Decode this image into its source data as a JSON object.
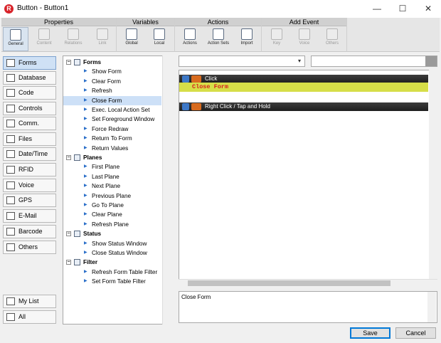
{
  "window": {
    "title": "Button - Button1",
    "app_icon_letter": "R",
    "controls": {
      "minimize": "—",
      "maximize": "☐",
      "close": "✕"
    }
  },
  "ribbon": {
    "groups": [
      {
        "label": "Properties",
        "buttons": [
          {
            "label": "General",
            "icon": "general-icon",
            "state": "selected"
          },
          {
            "label": "Content",
            "icon": "content-icon",
            "state": "disabled"
          },
          {
            "label": "Relations",
            "icon": "relations-icon",
            "state": "disabled"
          },
          {
            "label": "Link",
            "icon": "link-icon",
            "state": "disabled"
          }
        ]
      },
      {
        "label": "Variables",
        "buttons": [
          {
            "label": "Global",
            "icon": "global-variable-icon",
            "state": "normal"
          },
          {
            "label": "Local",
            "icon": "local-variable-icon",
            "state": "normal"
          }
        ]
      },
      {
        "label": "Actions",
        "buttons": [
          {
            "label": "Actions",
            "icon": "actions-icon",
            "state": "normal"
          },
          {
            "label": "Action Sets",
            "icon": "action-sets-icon",
            "state": "normal"
          },
          {
            "label": "Import",
            "icon": "import-icon",
            "state": "normal"
          }
        ]
      },
      {
        "label": "Add Event",
        "buttons": [
          {
            "label": "Key",
            "icon": "key-icon",
            "state": "disabled"
          },
          {
            "label": "Voice",
            "icon": "voice-icon",
            "state": "disabled"
          },
          {
            "label": "Others",
            "icon": "others-icon",
            "state": "disabled"
          }
        ]
      }
    ]
  },
  "nav": {
    "items": [
      {
        "label": "Forms",
        "icon": "forms-icon",
        "selected": true
      },
      {
        "label": "Database",
        "icon": "database-icon"
      },
      {
        "label": "Code",
        "icon": "code-icon"
      },
      {
        "label": "Controls",
        "icon": "controls-icon"
      },
      {
        "label": "Comm.",
        "icon": "comm-icon"
      },
      {
        "label": "Files",
        "icon": "files-icon"
      },
      {
        "label": "Date/Time",
        "icon": "date-time-icon"
      },
      {
        "label": "RFID",
        "icon": "rfid-icon"
      },
      {
        "label": "Voice",
        "icon": "voice-icon"
      },
      {
        "label": "GPS",
        "icon": "gps-icon"
      },
      {
        "label": "E-Mail",
        "icon": "email-icon"
      },
      {
        "label": "Barcode",
        "icon": "barcode-icon"
      },
      {
        "label": "Others",
        "icon": "others-icon"
      }
    ],
    "bottom": [
      {
        "label": "My List",
        "icon": "my-list-icon"
      },
      {
        "label": "All",
        "icon": "all-icon"
      }
    ]
  },
  "tree": {
    "categories": [
      {
        "label": "Forms",
        "icon": "forms-category-icon",
        "items": [
          "Show Form",
          "Clear Form",
          "Refresh",
          "Close Form",
          "Exec. Local Action Set",
          "Set Foreground Window",
          "Force Redraw",
          "Return To Form",
          "Return Values"
        ]
      },
      {
        "label": "Planes",
        "icon": "planes-category-icon",
        "items": [
          "First Plane",
          "Last Plane",
          "Next Plane",
          "Previous Plane",
          "Go To Plane",
          "Clear Plane",
          "Refresh Plane"
        ]
      },
      {
        "label": "Status",
        "icon": "status-category-icon",
        "items": [
          "Show Status Window",
          "Close Status Window"
        ]
      },
      {
        "label": "Filter",
        "icon": "filter-category-icon",
        "items": [
          "Refresh Form Table Filter",
          "Set Form Table Filter"
        ]
      }
    ],
    "selected": "Close Form",
    "expander": "−"
  },
  "script": {
    "events": [
      {
        "label": "Click",
        "actions": [
          "Close Form"
        ]
      },
      {
        "label": "Right Click / Tap and Hold",
        "actions": []
      }
    ]
  },
  "description": "Close Form",
  "buttons": {
    "save": "Save",
    "cancel": "Cancel"
  },
  "colors": {
    "event_bar": "#2a2a2a",
    "action_highlight": "#d6de48",
    "action_text": "#d81f1f",
    "selection": "#cde0f7"
  }
}
